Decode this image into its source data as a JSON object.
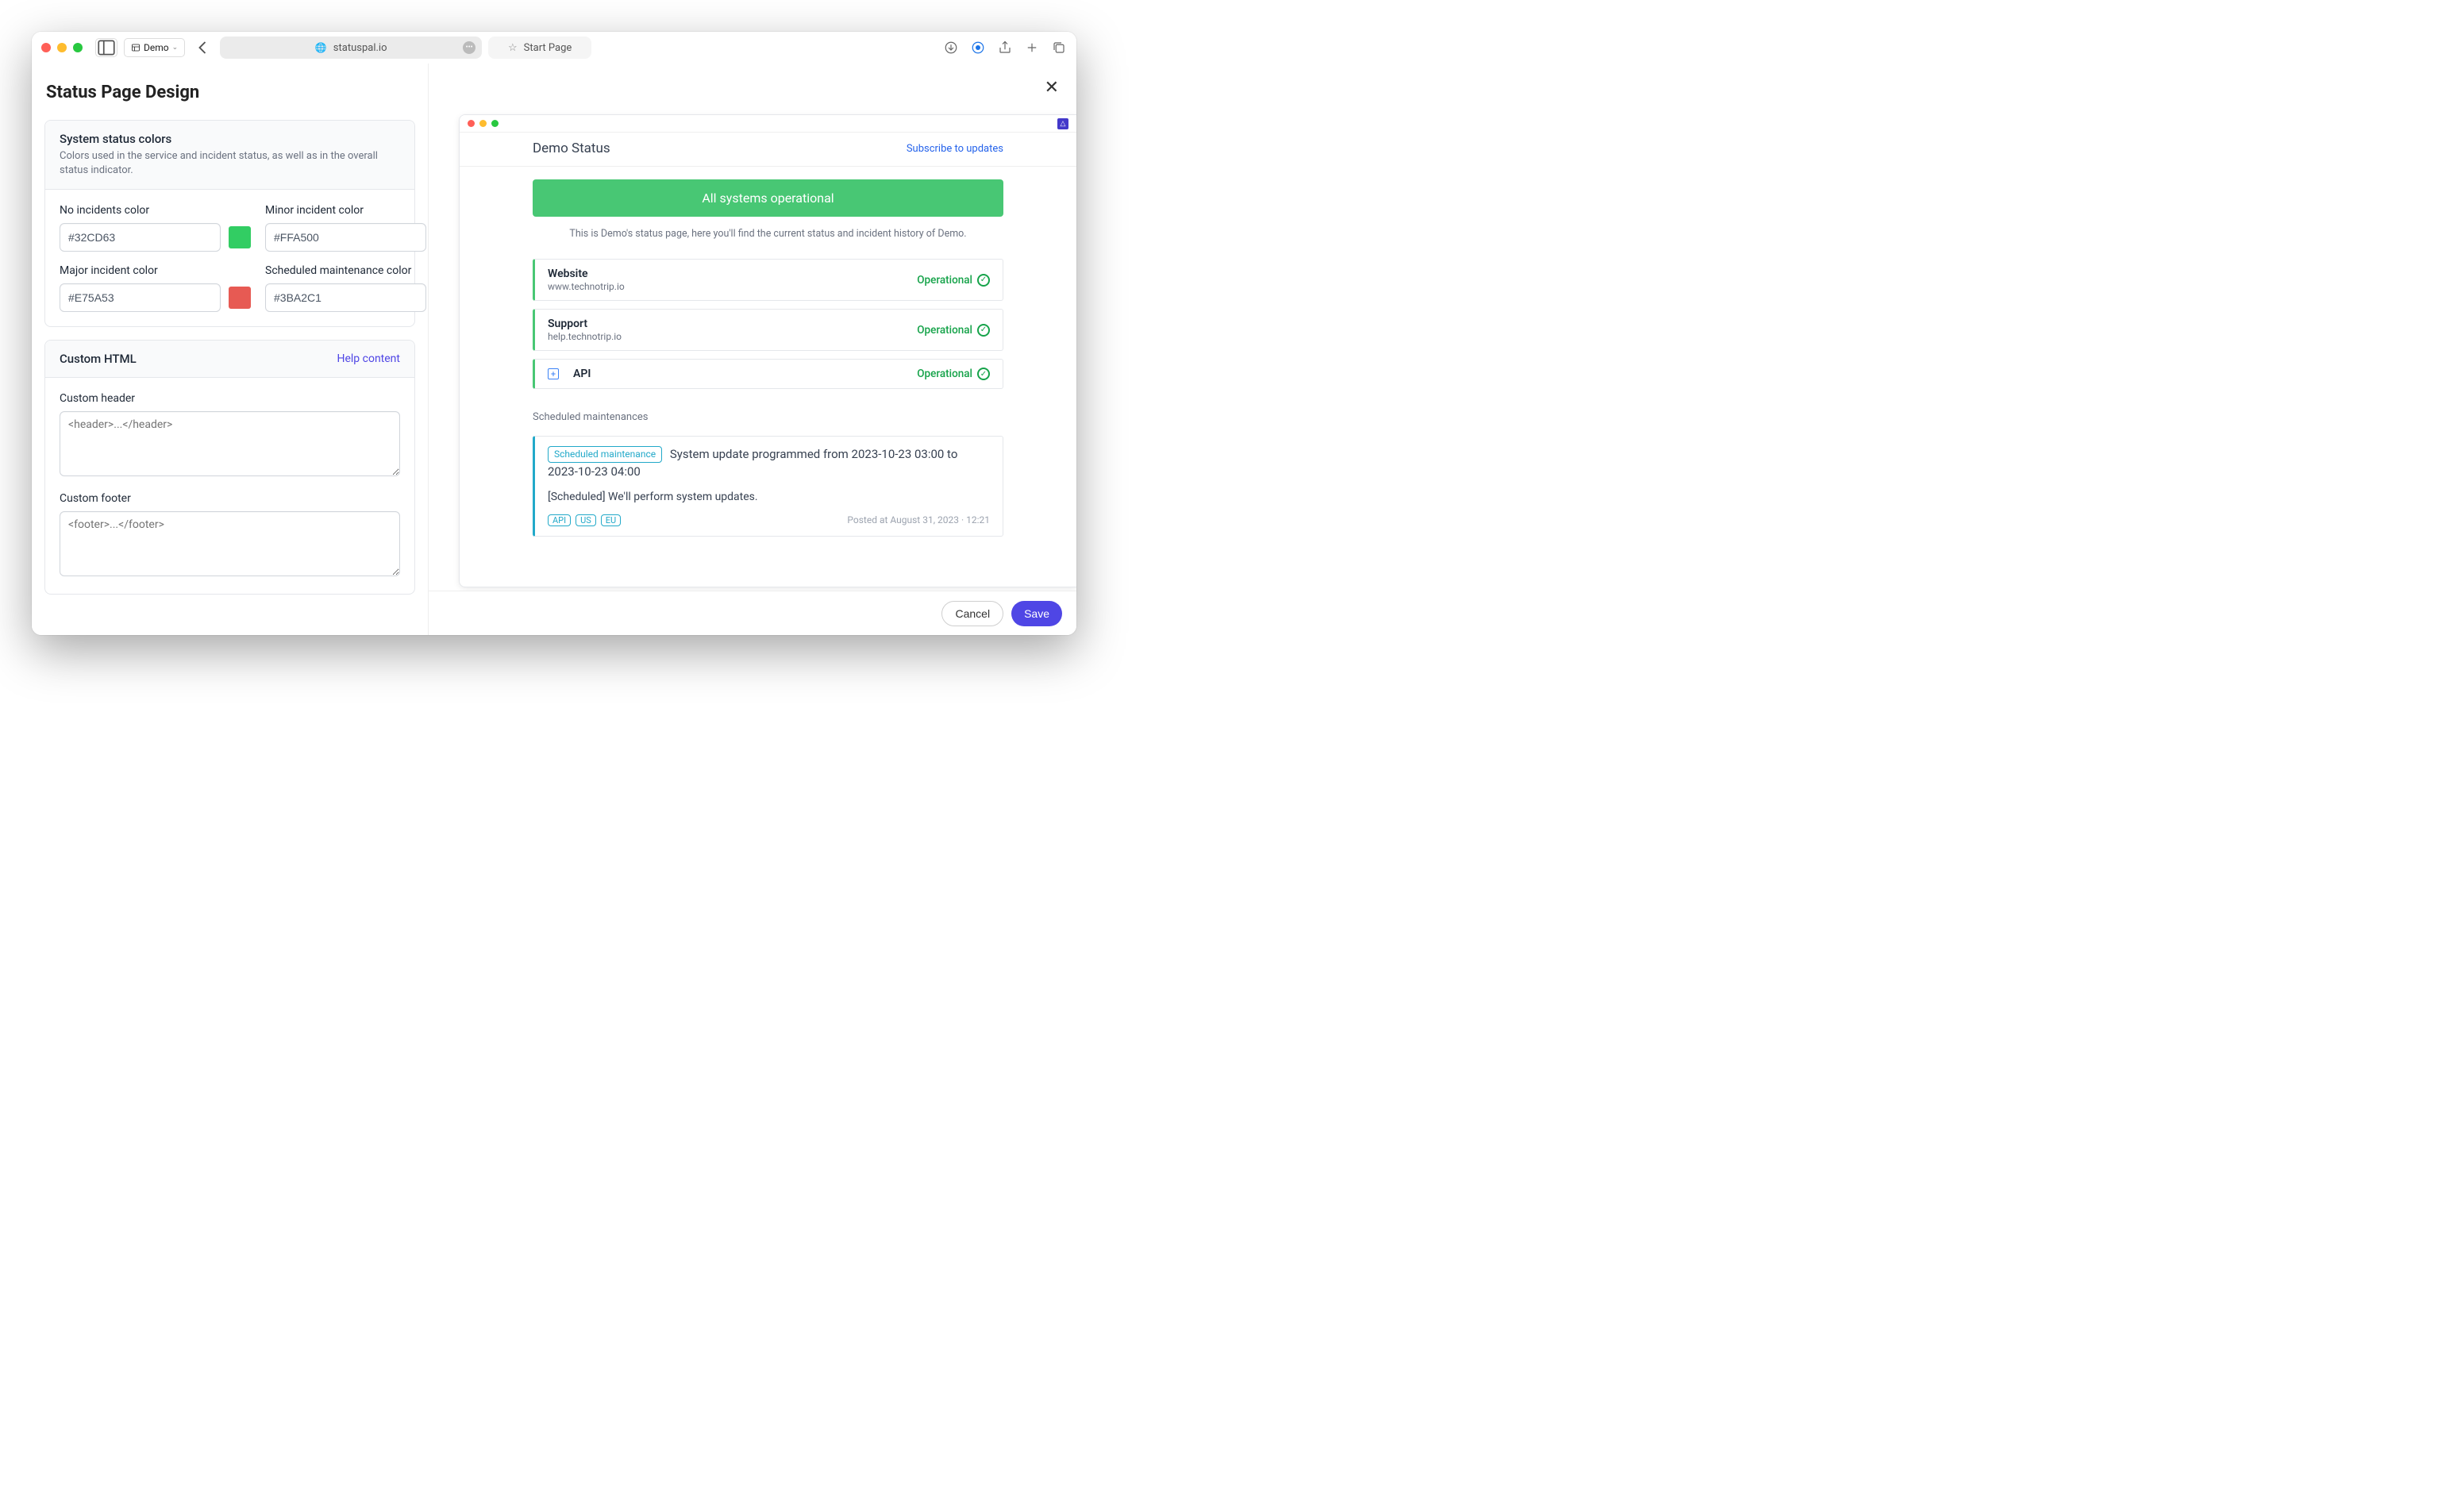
{
  "browser": {
    "profile_label": "Demo",
    "active_tab_url": "statuspal.io",
    "start_tab_label": "Start Page"
  },
  "page_title": "Status Page Design",
  "status_colors_card": {
    "title": "System status colors",
    "description": "Colors used in the service and incident status, as well as in the overall status indicator.",
    "fields": {
      "no_incidents": {
        "label": "No incidents color",
        "value": "#32CD63",
        "hex": "#32CD63"
      },
      "minor": {
        "label": "Minor incident color",
        "value": "#FFA500",
        "hex": "#FFA500"
      },
      "major": {
        "label": "Major incident color",
        "value": "#E75A53",
        "hex": "#E75A53"
      },
      "scheduled": {
        "label": "Scheduled maintenance color",
        "value": "#3BA2C1",
        "hex": "#3BA2C1"
      }
    }
  },
  "custom_html_card": {
    "title": "Custom HTML",
    "help_link": "Help content",
    "header_label": "Custom header",
    "header_placeholder": "<header>...</header>",
    "footer_label": "Custom footer",
    "footer_placeholder": "<footer>...</footer>"
  },
  "preview": {
    "title": "Demo Status",
    "subscribe": "Subscribe to updates",
    "banner": "All systems operational",
    "description": "This is Demo's status page, here you'll find the current status and incident history of Demo.",
    "services": [
      {
        "name": "Website",
        "url": "www.technotrip.io",
        "status": "Operational",
        "expandable": false
      },
      {
        "name": "Support",
        "url": "help.technotrip.io",
        "status": "Operational",
        "expandable": false
      },
      {
        "name": "API",
        "url": "",
        "status": "Operational",
        "expandable": true
      }
    ],
    "scheduled_heading": "Scheduled maintenances",
    "maintenance": {
      "badge": "Scheduled maintenance",
      "title": "System update programmed from 2023-10-23 03:00 to 2023-10-23 04:00",
      "body": "[Scheduled] We'll perform system updates.",
      "tags": [
        "API",
        "US",
        "EU"
      ],
      "posted": "Posted at August 31, 2023 · 12:21"
    }
  },
  "footer": {
    "cancel": "Cancel",
    "save": "Save"
  }
}
